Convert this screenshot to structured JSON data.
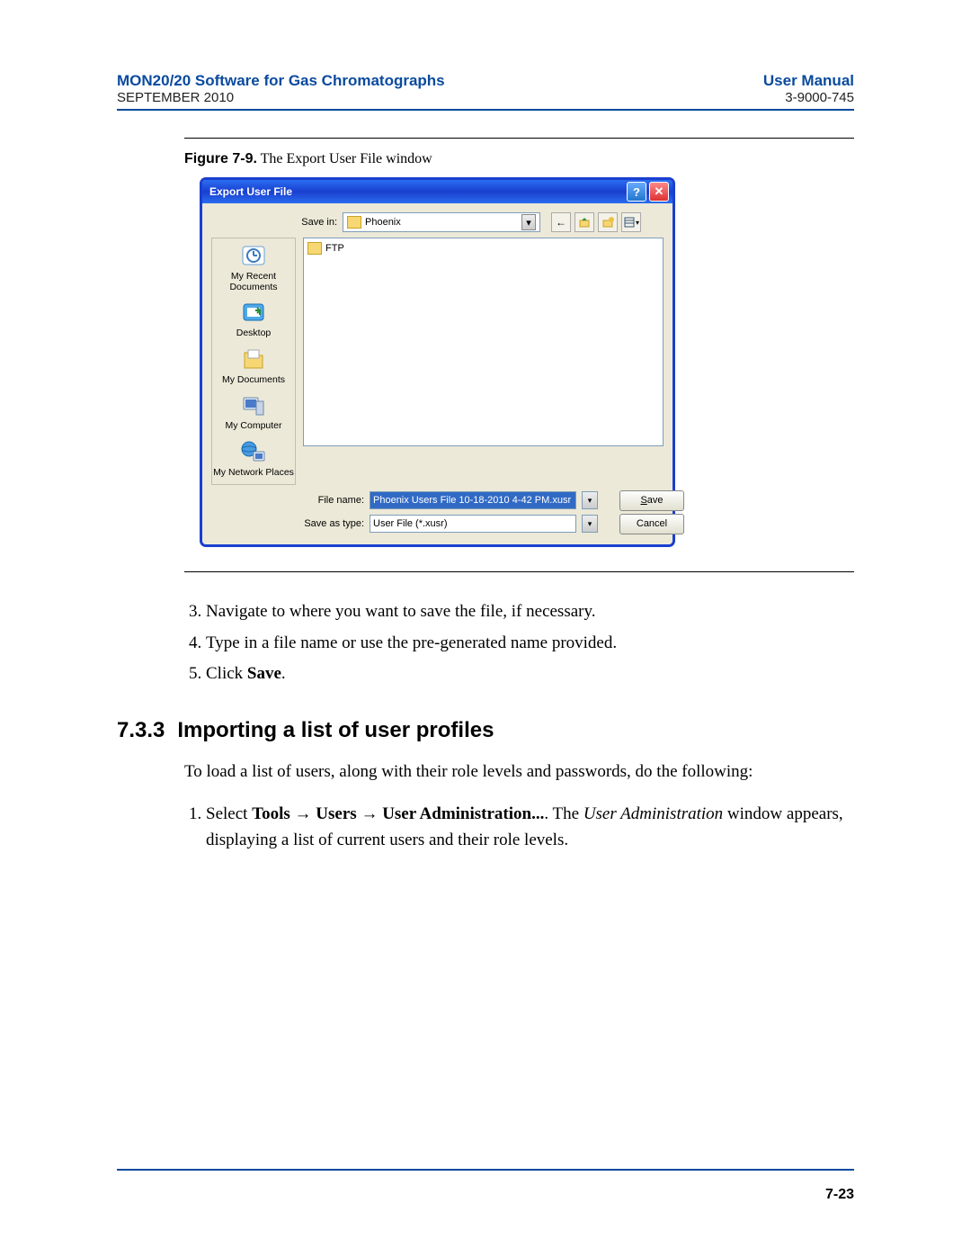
{
  "header": {
    "title_left": "MON20/20 Software for Gas Chromatographs",
    "date": "SEPTEMBER 2010",
    "title_right": "User Manual",
    "docnum": "3-9000-745"
  },
  "figure": {
    "label": "Figure 7-9.",
    "caption": "The Export User File window"
  },
  "dialog": {
    "title": "Export User File",
    "savein_label": "Save in:",
    "savein_value": "Phoenix",
    "file_list_item": "FTP",
    "places": {
      "recent": "My Recent Documents",
      "desktop": "Desktop",
      "mydocs": "My Documents",
      "mycomp": "My Computer",
      "mynet": "My Network Places"
    },
    "filename_label": "File name:",
    "filename_value": "Phoenix Users File 10-18-2010 4-42 PM.xusr",
    "saveastype_label": "Save as type:",
    "saveastype_value": "User File (*.xusr)",
    "save_btn": "Save",
    "cancel_btn": "Cancel"
  },
  "steps_a": {
    "s3": "Navigate to where you want to save the file, if necessary.",
    "s4": "Type in a file name or use the pre-generated name provided.",
    "s5_pre": "Click ",
    "s5_b": "Save",
    "s5_post": "."
  },
  "section": {
    "num": "7.3.3",
    "title": "Importing a list of user profiles"
  },
  "para": "To load a list of users, along with their role levels and passwords, do the following:",
  "steps_b": {
    "s1_a": "Select ",
    "s1_b1": "Tools",
    "s1_arrow": " → ",
    "s1_b2": "Users",
    "s1_b3": "User Administration...",
    "s1_c": ".  The ",
    "s1_i": "User Administration",
    "s1_d": " window appears, displaying a list of current users and their role levels."
  },
  "pagenum": "7-23"
}
